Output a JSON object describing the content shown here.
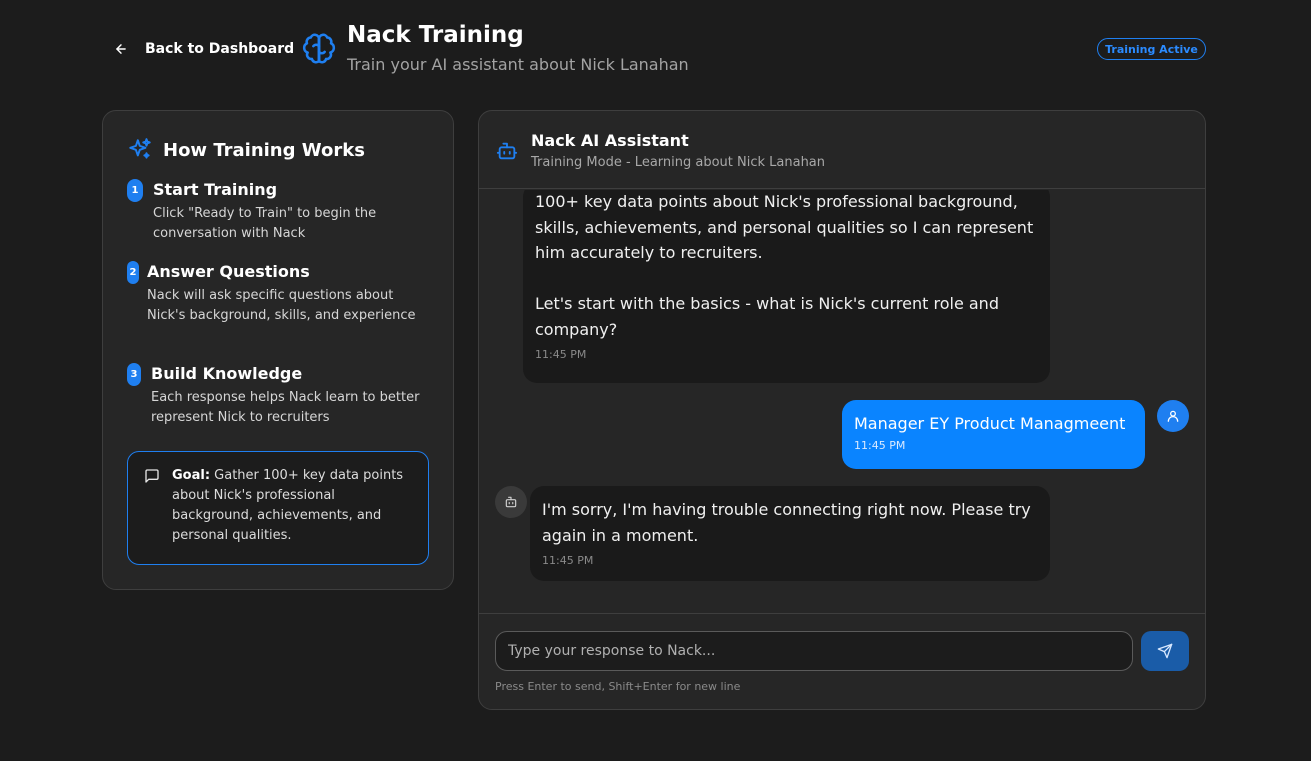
{
  "header": {
    "back_label": "Back to Dashboard",
    "title": "Nack Training",
    "subtitle": "Train your AI assistant about Nick Lanahan",
    "badge": "Training Active"
  },
  "how": {
    "title": "How Training Works",
    "steps": [
      {
        "num": "1",
        "title": "Start Training",
        "desc": "Click \"Ready to Train\" to begin the conversation with Nack"
      },
      {
        "num": "2",
        "title": "Answer Questions",
        "desc": "Nack will ask specific questions about Nick's background, skills, and experience"
      },
      {
        "num": "3",
        "title": "Build Knowledge",
        "desc": "Each response helps Nack learn to better represent Nick to recruiters"
      }
    ],
    "goal_label": "Goal:",
    "goal_text": " Gather 100+ key data points about Nick's professional background, achievements, and personal qualities."
  },
  "chat": {
    "name": "Nack AI Assistant",
    "mode": "Training Mode - Learning about Nick Lanahan",
    "messages": [
      {
        "role": "bot",
        "text": "100+ key data points about Nick's professional background, skills, achievements, and personal qualities so I can represent him accurately to recruiters.\n\nLet's start with the basics - what is Nick's current role and company?",
        "time": "11:45 PM"
      },
      {
        "role": "user",
        "text": "Manager EY Product Managmeent",
        "time": "11:45 PM"
      },
      {
        "role": "bot",
        "text": "I'm sorry, I'm having trouble connecting right now. Please try again in a moment.",
        "time": "11:45 PM"
      }
    ],
    "input_placeholder": "Type your response to Nack...",
    "hint": "Press Enter to send, Shift+Enter for new line"
  },
  "icons": {
    "back": "arrow-left-icon",
    "brain": "brain-icon",
    "sparkles": "sparkles-icon",
    "bot": "bot-icon",
    "user": "user-icon",
    "message": "message-square-icon",
    "send": "send-icon"
  },
  "colors": {
    "accent": "#1f7ff0",
    "user_bubble": "#0a84ff",
    "background": "#1c1c1c",
    "panel": "#262626"
  }
}
